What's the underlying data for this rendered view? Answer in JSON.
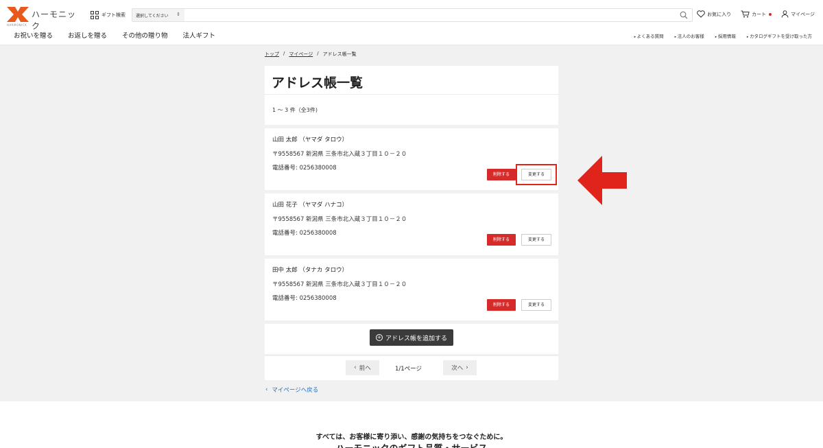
{
  "header": {
    "logo_text": "ハーモニック",
    "logo_sub": "HARMONICK",
    "gift_search_label": "ギフト検索",
    "search_select_value": "選択してください",
    "links": {
      "favorites": "お気に入り",
      "cart": "カート",
      "mypage": "マイページ"
    },
    "colors": {
      "brand": "#e85a1c",
      "accent_red": "#d52b2b"
    }
  },
  "nav": {
    "main": [
      "お祝いを贈る",
      "お返しを贈る",
      "その他の贈り物",
      "法人ギフト"
    ],
    "sub": [
      "よくある質問",
      "法人のお客様",
      "採用情報",
      "カタログギフトを受け取った方"
    ]
  },
  "breadcrumb": {
    "items": [
      "トップ",
      "マイページ",
      "アドレス帳一覧"
    ],
    "separator": "/"
  },
  "page": {
    "title": "アドレス帳一覧",
    "count_text": "1 〜 3 件（全3件)"
  },
  "addresses": [
    {
      "name": "山田 太郎 （ヤマダ タロウ）",
      "address": "〒9558567 新潟県 三条市北入蔵３丁目１０－２０",
      "phone": "電話番号: 0256380008",
      "delete_label": "削除する",
      "edit_label": "変更する"
    },
    {
      "name": "山田 花子 （ヤマダ ハナコ）",
      "address": "〒9558567 新潟県 三条市北入蔵３丁目１０－２０",
      "phone": "電話番号: 0256380008",
      "delete_label": "削除する",
      "edit_label": "変更する"
    },
    {
      "name": "田中 太郎 （タナカ タロウ）",
      "address": "〒9558567 新潟県 三条市北入蔵３丁目１０－２０",
      "phone": "電話番号: 0256380008",
      "delete_label": "削除する",
      "edit_label": "変更する"
    }
  ],
  "add_button_label": "アドレス帳を追加する",
  "pager": {
    "prev": "前へ",
    "info": "1/1ページ",
    "next": "次へ"
  },
  "back_link": "マイページへ戻る",
  "footer": {
    "line1": "すべては、お客様に寄り添い、感謝の気持ちをつなぐために。",
    "line2": "ハーモニックのギフト品質・サービス"
  },
  "annotation": {
    "color": "#e0241c",
    "icon": "arrow-left-icon"
  }
}
